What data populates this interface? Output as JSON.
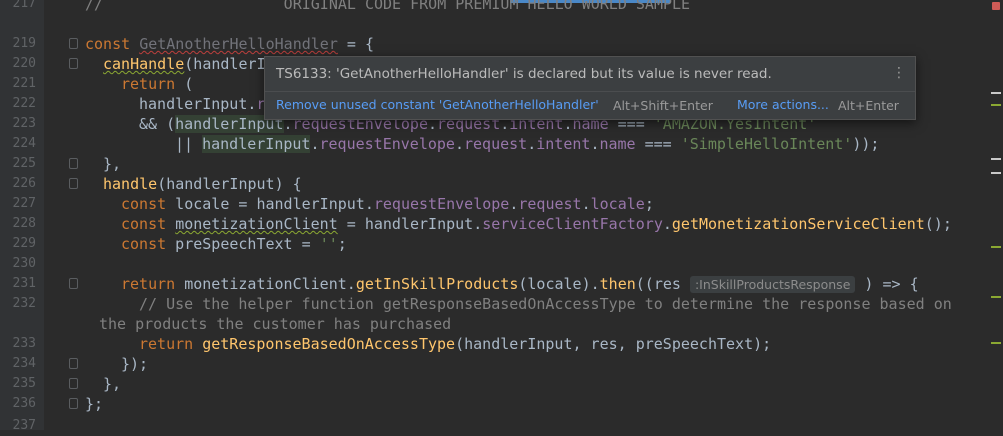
{
  "line_numbers": [
    "217",
    "219",
    "220",
    "221",
    "222",
    "223",
    "224",
    "225",
    "226",
    "227",
    "228",
    "229",
    "230",
    "231",
    "232",
    "",
    "233",
    "234",
    "235",
    "236",
    "237"
  ],
  "code": {
    "l217": "//                    ORIGINAL CODE FROM PREMIUM HELLO WORLD SAMPLE",
    "l219_kw": "const",
    "l219_name": "GetAnotherHelloHandler",
    "l219_rest": " = {",
    "l220_fn": "canHandle",
    "l220_rest": "(handlerI",
    "l221_kw": "return",
    "l221_rest": " (",
    "l222_a": "handlerInput.",
    "l222_b": "r",
    "l223_amp": "&& (",
    "l223_a": "handlerInput",
    "l223_b": ".",
    "l223_c": "requestEnvelope",
    "l223_d": ".",
    "l223_e": "request",
    "l223_f": ".",
    "l223_g": "intent",
    "l223_h": ".",
    "l223_i": "name",
    "l223_j": " === ",
    "l223_s": "'AMAZON.YesIntent'",
    "l224_or": "|| ",
    "l224_a": "handlerInput",
    "l224_b": ".",
    "l224_c": "requestEnvelope",
    "l224_d": ".",
    "l224_e": "request",
    "l224_f": ".",
    "l224_g": "intent",
    "l224_h": ".",
    "l224_i": "name",
    "l224_j": " === ",
    "l224_s": "'SimpleHelloIntent'",
    "l224_end": "));",
    "l225": "},",
    "l226_fn": "handle",
    "l226_rest": "(handlerInput) {",
    "l227_kw": "const",
    "l227_a": " locale = handlerInput.",
    "l227_p1": "requestEnvelope",
    "l227_d1": ".",
    "l227_p2": "request",
    "l227_d2": ".",
    "l227_p3": "locale",
    "l227_end": ";",
    "l228_kw": "const",
    "l228_sp": " ",
    "l228_name": "monetizationClient",
    "l228_a": " = handlerInput.",
    "l228_p": "serviceClientFactory",
    "l228_d": ".",
    "l228_f": "getMonetizationServiceClient",
    "l228_end": "();",
    "l229_kw": "const",
    "l229_a": " preSpeechText = ",
    "l229_s": "''",
    "l229_end": ";",
    "l231_kw": "return",
    "l231_a": " monetizationClient.",
    "l231_f": "getInSkillProducts",
    "l231_b": "(locale).",
    "l231_f2": "then",
    "l231_c": "((res",
    "l231_hint": ":InSkillProductsResponse",
    "l231_end": " ) => {",
    "l232": "// Use the helper function getResponseBasedOnAccessType to determine the response based on",
    "l232b": "the products the customer has purchased",
    "l233_kw": "return",
    "l233_sp": " ",
    "l233_f": "getResponseBasedOnAccessType",
    "l233_rest": "(handlerInput, res, preSpeechText);",
    "l234": "});",
    "l235": "},",
    "l236": "};"
  },
  "popup": {
    "message": "TS6133: 'GetAnotherHelloHandler' is declared but its value is never read.",
    "fix_label": "Remove unused constant 'GetAnotherHelloHandler'",
    "fix_shortcut": "Alt+Shift+Enter",
    "more_label": "More actions...",
    "more_shortcut": "Alt+Enter",
    "menu_icon": "⋮"
  },
  "colors": {
    "background": "#2b2b2b",
    "keyword": "#cc7832",
    "string": "#6a8759",
    "property": "#9876aa",
    "function": "#ffc66d",
    "comment": "#808080",
    "link": "#589df6",
    "error": "#bc3f3c"
  }
}
